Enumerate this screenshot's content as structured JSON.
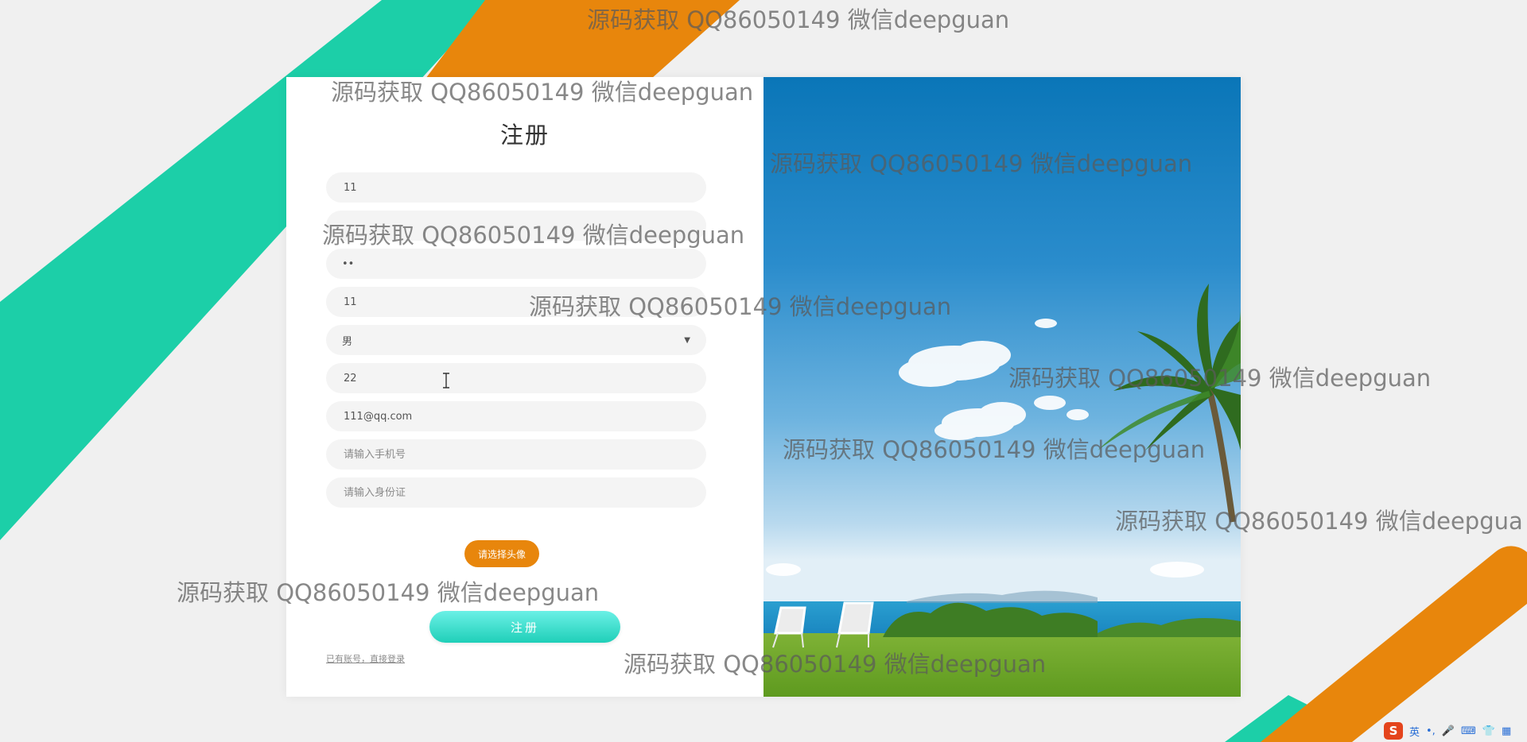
{
  "form": {
    "title": "注册",
    "fields": [
      {
        "value": "11",
        "placeholder": ""
      },
      {
        "value": "",
        "placeholder": ""
      },
      {
        "value": "••",
        "placeholder": ""
      },
      {
        "value": "11",
        "placeholder": ""
      },
      {
        "value": "男",
        "placeholder": ""
      },
      {
        "value": "22",
        "placeholder": ""
      },
      {
        "value": "111@qq.com",
        "placeholder": ""
      },
      {
        "value": "",
        "placeholder": "请输入手机号"
      },
      {
        "value": "",
        "placeholder": "请输入身份证"
      }
    ],
    "avatar_button": "请选择头像",
    "submit_button": "注册",
    "login_link": "已有账号，直接登录"
  },
  "watermark": {
    "text": "源码获取 QQ86050149 微信deepguan",
    "text_cut": "源码获取 QQ86050149 微信deepgua"
  },
  "ime": {
    "logo": "S",
    "mode": "英",
    "punct": "•,",
    "mic": "🎤",
    "keyboard": "⌨",
    "skin": "👕",
    "grid": "▦"
  },
  "colors": {
    "teal": "#1ccfa8",
    "orange": "#e8860c",
    "submit": "#2fd8c4"
  }
}
